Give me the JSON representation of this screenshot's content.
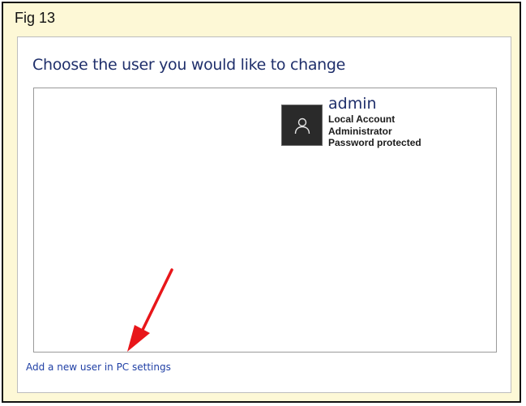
{
  "figure": {
    "label": "Fig 13"
  },
  "page": {
    "title": "Choose the user you would like to change"
  },
  "users": [
    {
      "name": "admin",
      "account_type": "Local Account",
      "role": "Administrator",
      "security": "Password protected",
      "icon": "user-icon"
    }
  ],
  "actions": {
    "add_user_link": "Add a new user in PC settings"
  },
  "colors": {
    "frame_background": "#fdf8d6",
    "title_text": "#1f2f6b",
    "link_text": "#1f3fa5",
    "avatar_background": "#2a2a2a",
    "annotation_arrow": "#e8161a"
  }
}
